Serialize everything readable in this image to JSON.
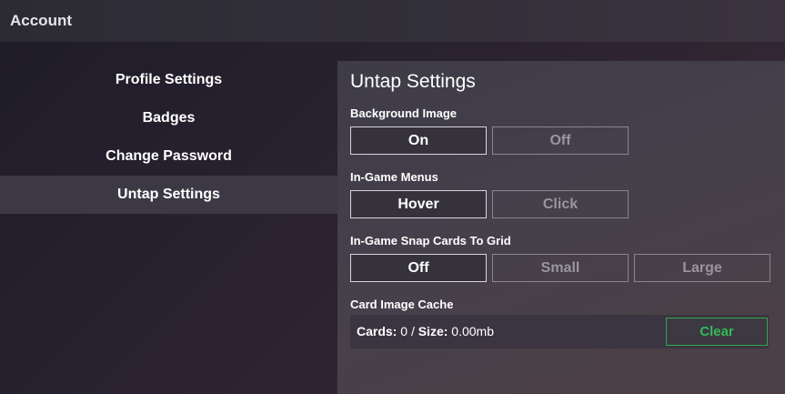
{
  "window": {
    "title": "Account"
  },
  "sidebar": {
    "items": [
      {
        "label": "Profile Settings"
      },
      {
        "label": "Badges"
      },
      {
        "label": "Change Password"
      },
      {
        "label": "Untap Settings",
        "active": true
      }
    ]
  },
  "panel": {
    "title": "Untap Settings",
    "background_image": {
      "label": "Background Image",
      "options": [
        "On",
        "Off"
      ],
      "selected": "On"
    },
    "in_game_menus": {
      "label": "In-Game Menus",
      "options": [
        "Hover",
        "Click"
      ],
      "selected": "Hover"
    },
    "snap_to_grid": {
      "label": "In-Game Snap Cards To Grid",
      "options": [
        "Off",
        "Small",
        "Large"
      ],
      "selected": "Off"
    },
    "card_cache": {
      "label": "Card Image Cache",
      "cards_label": "Cards:",
      "cards_value": "0",
      "separator": "/",
      "size_label": "Size:",
      "size_value": "0.00mb",
      "clear_label": "Clear"
    }
  },
  "colors": {
    "accent_green": "#35b857",
    "selected_border": "#d8d6dc",
    "unselected_text": "#9a959f"
  }
}
